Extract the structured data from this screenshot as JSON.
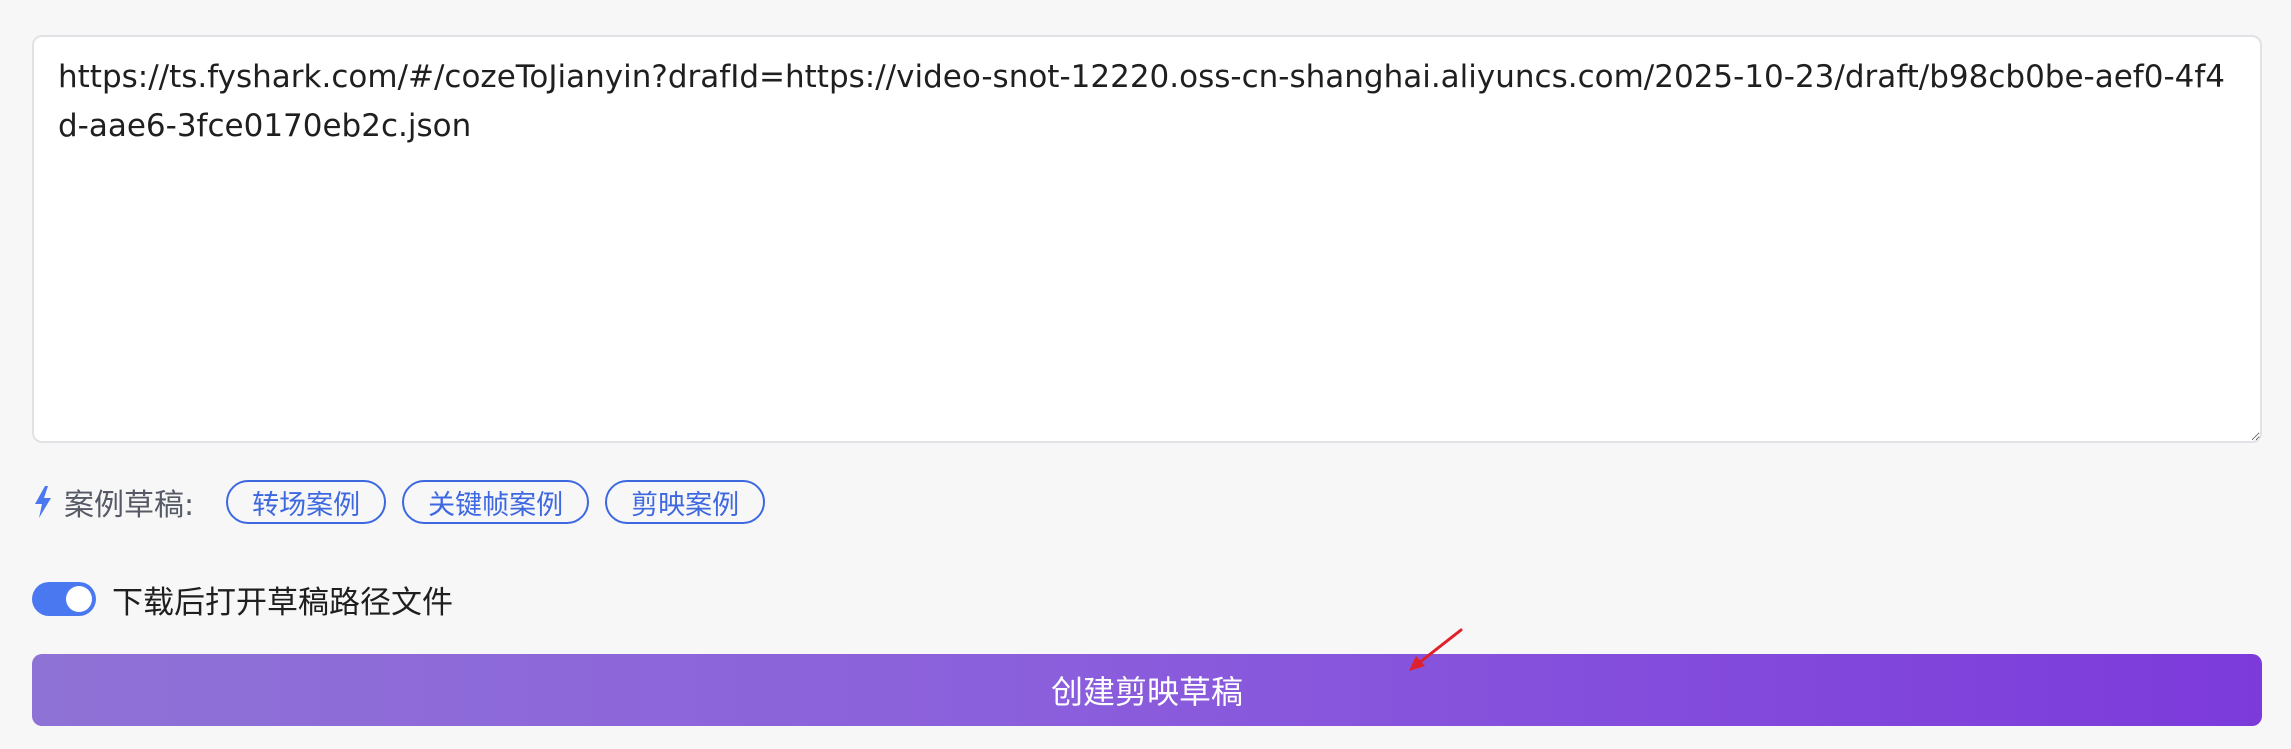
{
  "url_input": {
    "value": "https://ts.fyshark.com/#/cozeToJianyin?drafId=https://video-snot-12220.oss-cn-shanghai.aliyuncs.com/2025-10-23/draft/b98cb0be-aef0-4f4d-aae6-3fce0170eb2c.json"
  },
  "examples": {
    "icon": "lightning-icon",
    "label": "案例草稿:",
    "chips": [
      {
        "label": "转场案例"
      },
      {
        "label": "关键帧案例"
      },
      {
        "label": "剪映案例"
      }
    ]
  },
  "toggle": {
    "label": "下载后打开草稿路径文件",
    "on": true
  },
  "create_button": {
    "label": "创建剪映草稿"
  },
  "colors": {
    "accent_blue": "#3d68e0",
    "toggle_on": "#4a78f0",
    "button_gradient_start": "#8f72d6",
    "button_gradient_end": "#7c3adb",
    "annotation_arrow": "#e0202a"
  }
}
